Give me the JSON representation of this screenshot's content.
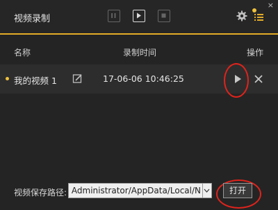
{
  "window": {
    "title": "视频录制",
    "close_glyph": "×",
    "accent_color": "#e4ad27",
    "alert_color": "#e0231c"
  },
  "toolbar": {
    "controls": [
      "pause-icon",
      "play-icon",
      "stop-icon",
      "gear-icon",
      "list-icon"
    ]
  },
  "table": {
    "columns": [
      "名称",
      "录制时间",
      "操作"
    ],
    "rows": [
      {
        "name": "我的视频 1",
        "time": "17-06-06 10:46:25",
        "actions": [
          "edit-icon",
          "play-icon",
          "delete-icon"
        ]
      }
    ]
  },
  "footer": {
    "path_label": "视频保存路径:",
    "path_value": "Administrator/AppData/Local/N",
    "open_button": "打开"
  }
}
